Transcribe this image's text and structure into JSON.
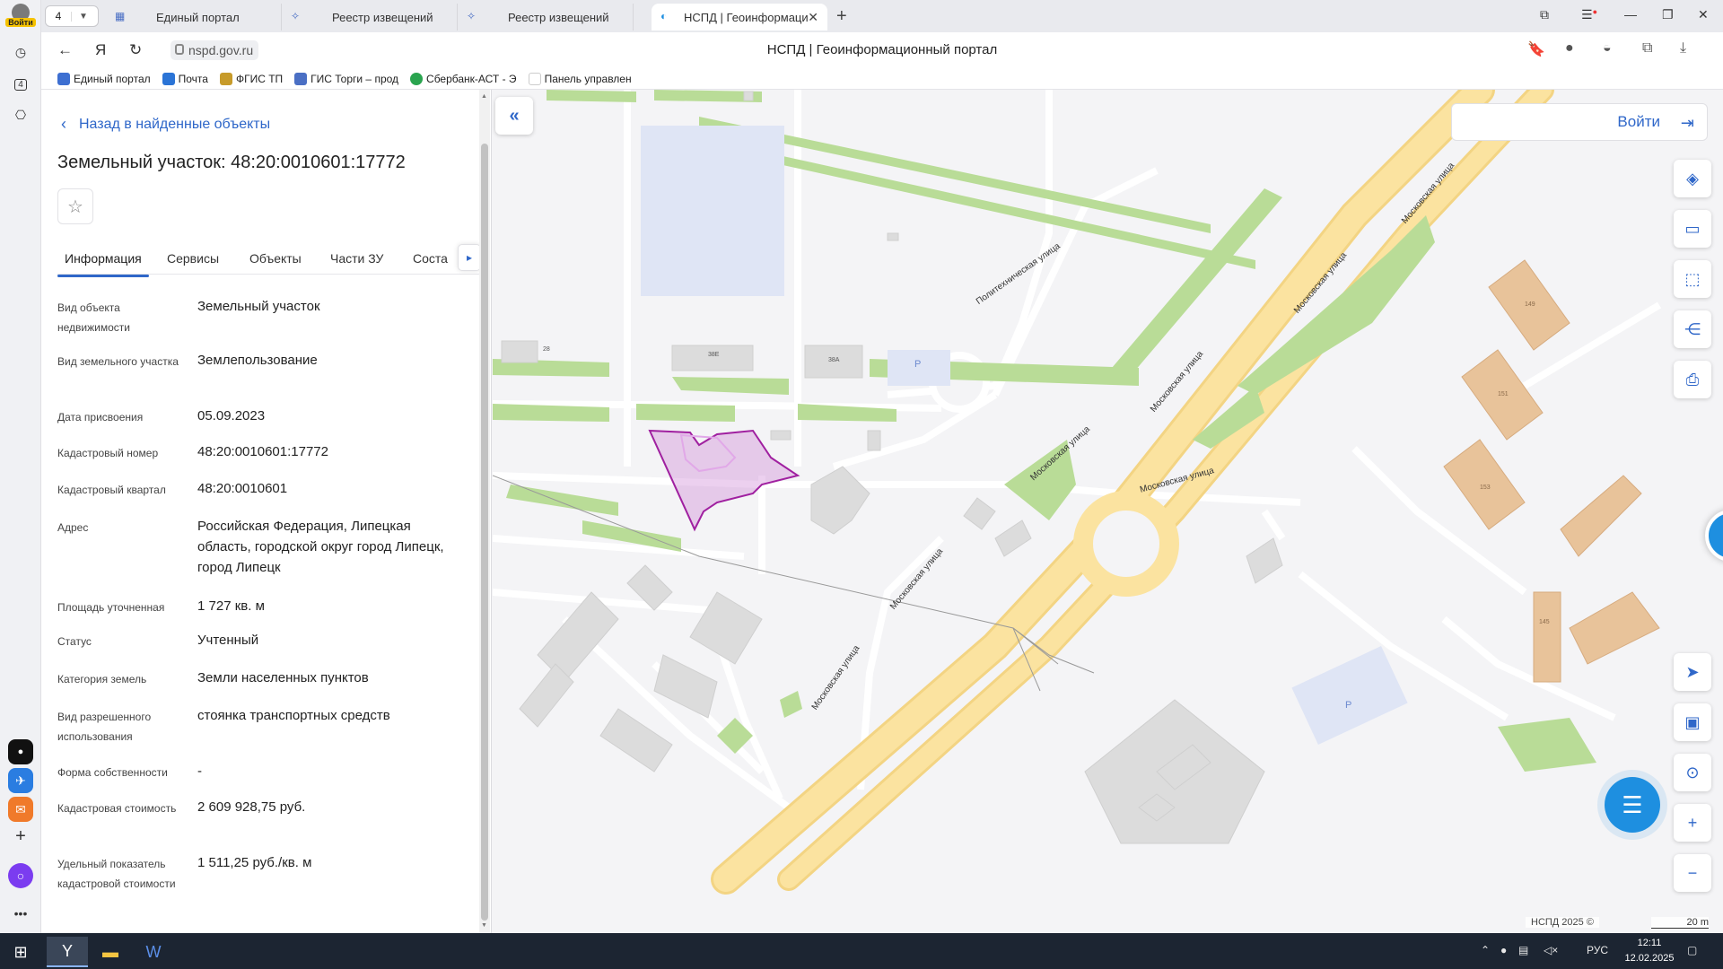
{
  "browser": {
    "login_label": "Войти",
    "tab_count": "4",
    "tabs": [
      {
        "title": "Единый портал"
      },
      {
        "title": "Реестр извещений"
      },
      {
        "title": "Реестр извещений"
      },
      {
        "title": "НСПД | Геоинформаци"
      }
    ],
    "url": "nspd.gov.ru",
    "page_title": "НСПД | Геоинформационный портал",
    "bookmarks": [
      {
        "label": "Единый портал",
        "color": "#3d6fd1"
      },
      {
        "label": "Почта",
        "color": "#2b74d6"
      },
      {
        "label": "ФГИС ТП",
        "color": "#c79b2a"
      },
      {
        "label": "ГИС Торги – прод",
        "color": "#4a6fc4"
      },
      {
        "label": "Сбербанк-АСТ - Э",
        "color": "#2aa44f"
      },
      {
        "label": "Панель управлен",
        "color": "#222222"
      }
    ]
  },
  "panel": {
    "back_label": "Назад в найденные объекты",
    "title": "Земельный участок: 48:20:0010601:17772",
    "tabs": [
      "Информация",
      "Сервисы",
      "Объекты",
      "Части ЗУ",
      "Соста"
    ],
    "fields": [
      {
        "key": "Вид объекта недвижимости",
        "value": "Земельный участок"
      },
      {
        "key": "Вид земельного участка",
        "value": "Землепользование"
      },
      {
        "key": "Дата присвоения",
        "value": "05.09.2023"
      },
      {
        "key": "Кадастровый номер",
        "value": "48:20:0010601:17772"
      },
      {
        "key": "Кадастровый квартал",
        "value": "48:20:0010601"
      },
      {
        "key": "Адрес",
        "value": "Российская Федерация, Липецкая область, городской округ город Липецк, город Липецк"
      },
      {
        "key": "Площадь уточненная",
        "value": "1 727 кв. м"
      },
      {
        "key": "Статус",
        "value": "Учтенный"
      },
      {
        "key": "Категория земель",
        "value": "Земли населенных пунктов"
      },
      {
        "key": "Вид разрешенного использования",
        "value": "стоянка транспортных средств"
      },
      {
        "key": "Форма собственности",
        "value": "-"
      },
      {
        "key": "Кадастровая стоимость",
        "value": "2 609 928,75 руб."
      },
      {
        "key": "Удельный показатель кадастровой стоимости",
        "value": "1 511,25 руб./кв. м"
      }
    ]
  },
  "map": {
    "login_label": "Войти",
    "copyright": "НСПД 2025 ©",
    "scale": "20 m",
    "street_labels": [
      "Политехническая улица",
      "Московская улица",
      "Московская улица",
      "Московская улица",
      "Московская улица",
      "Московская улица",
      "Московская улица",
      "Московская улица"
    ],
    "building_labels": [
      "28",
      "38Е",
      "38А",
      "Р",
      "149",
      "151",
      "153",
      "145",
      "Р"
    ],
    "colors": {
      "road_main": "#fbe3a0",
      "green": "#b9dc97",
      "parcel": "#a020a0",
      "building": "#dcdcdc",
      "residential": "#e8c39a",
      "parking": "#dfe5f5"
    }
  },
  "taskbar": {
    "lang": "РУС",
    "time": "12:11",
    "date": "12.02.2025"
  }
}
